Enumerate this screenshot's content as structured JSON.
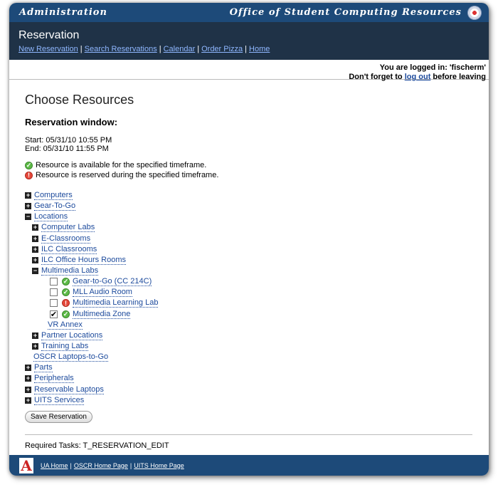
{
  "topbar": {
    "left": "Administration",
    "right": "Office of Student Computing Resources"
  },
  "header": {
    "title": "Reservation",
    "nav": [
      "New Reservation",
      "Search Reservations",
      "Calendar",
      "Order Pizza",
      "Home"
    ]
  },
  "login": {
    "line1": "You are logged in: 'fischerm'",
    "line2_prefix": "Don't forget to",
    "logout": "log out",
    "line2_suffix": "before leaving"
  },
  "page": {
    "title": "Choose Resources",
    "window_heading": "Reservation window:",
    "start": "Start: 05/31/10 10:55 PM",
    "end": "End: 05/31/10 11:55 PM",
    "legend_ok": "Resource is available for the specified timeframe.",
    "legend_bad": "Resource is reserved during the specified timeframe."
  },
  "tree": {
    "computers": "Computers",
    "gear": "Gear-To-Go",
    "locations": "Locations",
    "computer_labs": "Computer Labs",
    "eclass": "E-Classrooms",
    "ilc_class": "ILC Classrooms",
    "ilc_office": "ILC Office Hours Rooms",
    "mm_labs": "Multimedia Labs",
    "items": [
      {
        "label": "Gear-to-Go (CC 214C)",
        "checked": false,
        "status": "available"
      },
      {
        "label": "MLL Audio Room",
        "checked": false,
        "status": "available"
      },
      {
        "label": "Multimedia Learning Lab",
        "checked": false,
        "status": "reserved"
      },
      {
        "label": "Multimedia Zone",
        "checked": true,
        "status": "available"
      }
    ],
    "vr": "VR Annex",
    "partner": "Partner Locations",
    "training": "Training Labs",
    "laptops": "OSCR Laptops-to-Go",
    "parts": "Parts",
    "peripherals": "Peripherals",
    "reservable": "Reservable Laptops",
    "uits": "UITS Services"
  },
  "save_button": "Save Reservation",
  "required": "Required Tasks: T_RESERVATION_EDIT",
  "footer": {
    "logo": "A",
    "links": [
      "UA Home",
      "OSCR Home Page",
      "UITS Home Page"
    ]
  }
}
